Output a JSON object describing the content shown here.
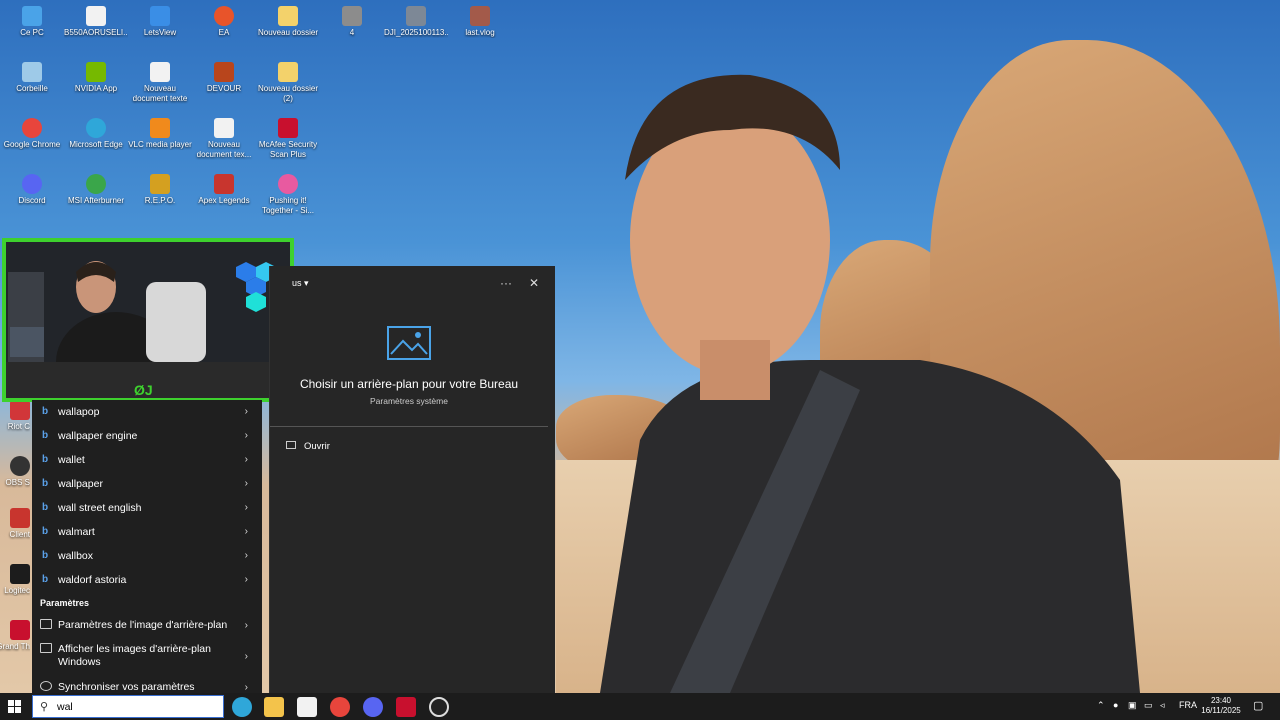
{
  "desktop": {
    "icons": [
      {
        "label": "Ce PC",
        "color": "#4aa3e8"
      },
      {
        "label": "B550AORUSELI...",
        "color": "#f2f2f2"
      },
      {
        "label": "LetsView",
        "color": "#3a8ee6"
      },
      {
        "label": "EA",
        "color": "#e8542a"
      },
      {
        "label": "Nouveau dossier",
        "color": "#f3d26b"
      },
      {
        "label": "4",
        "color": "#8c8c8c"
      },
      {
        "label": "DJI_2025100113...",
        "color": "#7d8896"
      },
      {
        "label": "last.vlog",
        "color": "#a35a4a"
      },
      {
        "label": "Corbeille",
        "color": "#9ecae8"
      },
      {
        "label": "NVIDIA App",
        "color": "#76b900"
      },
      {
        "label": "Nouveau document texte",
        "color": "#f2f2f2"
      },
      {
        "label": "DEVOUR",
        "color": "#b8451c"
      },
      {
        "label": "Nouveau dossier (2)",
        "color": "#f3d26b"
      },
      {
        "label": "Google Chrome",
        "color": "#e8453c"
      },
      {
        "label": "Microsoft Edge",
        "color": "#2fa7d9"
      },
      {
        "label": "VLC media player",
        "color": "#f08a1c"
      },
      {
        "label": "Nouveau document tex...",
        "color": "#f2f2f2"
      },
      {
        "label": "McAfee Security Scan Plus",
        "color": "#c8102e"
      },
      {
        "label": "Discord",
        "color": "#5865f2"
      },
      {
        "label": "MSI Afterburner",
        "color": "#3aa64a"
      },
      {
        "label": "R.E.P.O.",
        "color": "#d4a020"
      },
      {
        "label": "Apex Legends",
        "color": "#c8352e"
      },
      {
        "label": "Pushing it! Together - Si...",
        "color": "#e85aa0"
      }
    ],
    "partial_left": [
      "Riot C",
      "OBS S",
      "Client",
      "Logitec",
      "Grand Th"
    ]
  },
  "search_panel": {
    "suggestions": [
      {
        "label": "wallapop"
      },
      {
        "label": "wallpaper engine"
      },
      {
        "label": "wallet"
      },
      {
        "label": "wallpaper"
      },
      {
        "label": "wall street english"
      },
      {
        "label": "walmart"
      },
      {
        "label": "wallbox"
      },
      {
        "label": "waldorf astoria"
      }
    ],
    "settings_header": "Paramètres",
    "settings": [
      {
        "label": "Paramètres de l'image d'arrière-plan"
      },
      {
        "label": "Afficher les images d'arrière-plan Windows"
      },
      {
        "label": "Synchroniser vos paramètres"
      }
    ],
    "detail": {
      "dropdown_label": "us",
      "more": "···",
      "close": "✕",
      "title": "Choisir un arrière-plan pour votre Bureau",
      "subtitle": "Paramètres système",
      "action": "Ouvrir"
    }
  },
  "taskbar": {
    "search_value": "wal",
    "tray": {
      "language": "FRA",
      "time": "23:40",
      "date": "16/11/2025"
    },
    "apps": [
      {
        "name": "edge",
        "color": "#2fa7d9"
      },
      {
        "name": "explorer",
        "color": "#f3c34b"
      },
      {
        "name": "store",
        "color": "#f2f2f2"
      },
      {
        "name": "chrome",
        "color": "#e8453c"
      },
      {
        "name": "discord",
        "color": "#5865f2"
      },
      {
        "name": "voice",
        "color": "#c8102e"
      },
      {
        "name": "obs",
        "color": "#222222"
      }
    ]
  },
  "webcam": {
    "tag": "ØJ"
  }
}
